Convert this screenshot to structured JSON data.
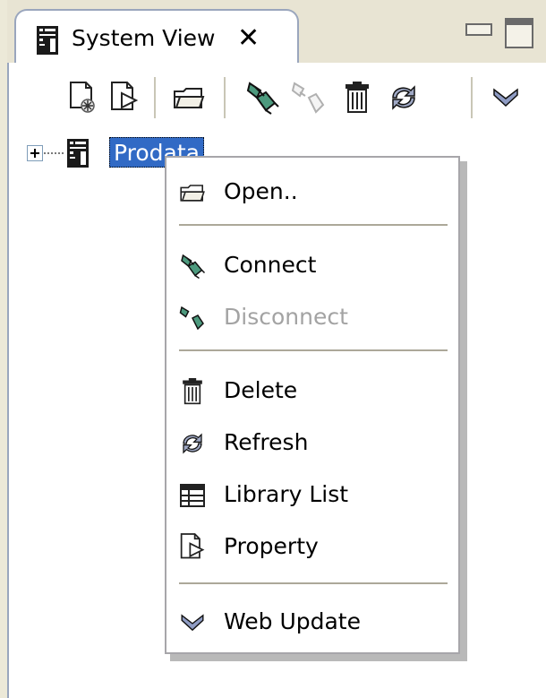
{
  "view": {
    "title": "System View",
    "close_glyph": "✕"
  },
  "toolbar": {
    "icons": [
      "new-connection-icon",
      "edit-properties-icon",
      "open-folder-icon",
      "connect-icon",
      "disconnect-icon",
      "delete-icon",
      "refresh-icon",
      "view-menu-chevron-icon"
    ]
  },
  "tree": {
    "node_label": "Prodata"
  },
  "context_menu": {
    "items": [
      {
        "label": "Open..",
        "icon": "open-folder-icon",
        "enabled": true
      },
      {
        "label": "Connect",
        "icon": "connect-icon",
        "enabled": true
      },
      {
        "label": "Disconnect",
        "icon": "disconnect-icon",
        "enabled": false
      },
      {
        "label": "Delete",
        "icon": "delete-icon",
        "enabled": true
      },
      {
        "label": "Refresh",
        "icon": "refresh-icon",
        "enabled": true
      },
      {
        "label": "Library List",
        "icon": "library-list-icon",
        "enabled": true
      },
      {
        "label": "Property",
        "icon": "property-icon",
        "enabled": true
      },
      {
        "label": "Web Update",
        "icon": "web-update-chevron-icon",
        "enabled": true
      }
    ]
  },
  "colors": {
    "selection": "#316ac5",
    "connect_green": "#4d9a7e",
    "panel_bg": "#ece9d8",
    "disabled_text": "#a3a3a3"
  }
}
